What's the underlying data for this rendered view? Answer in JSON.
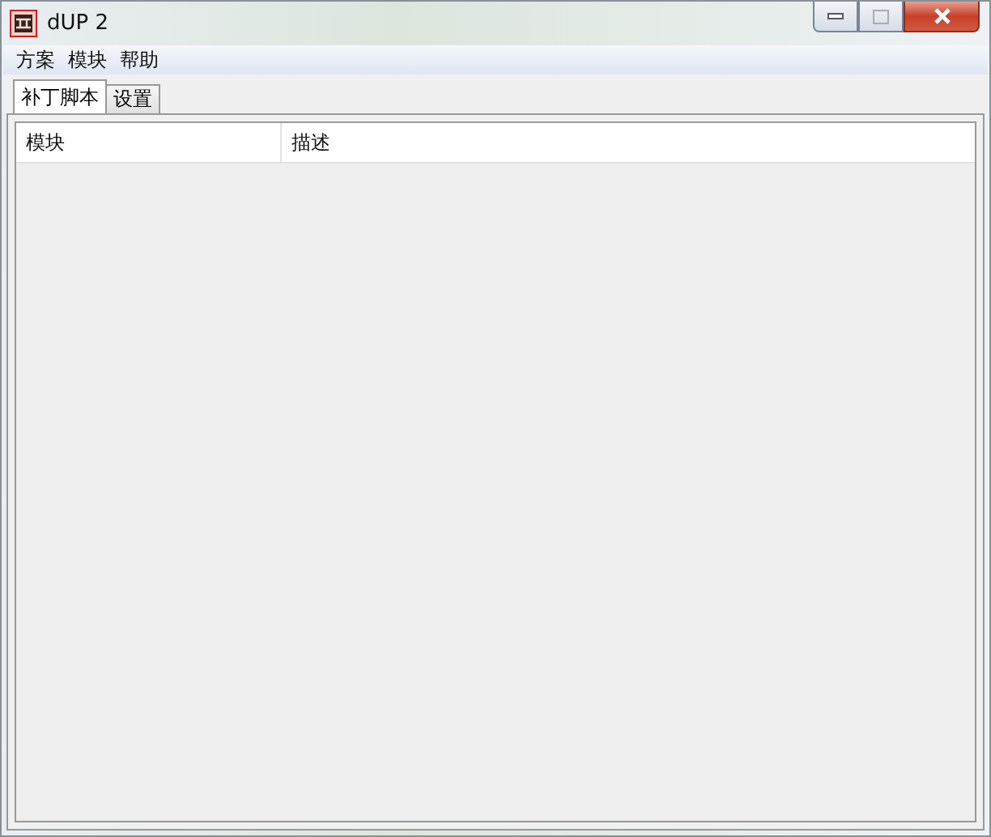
{
  "window": {
    "title": "dUP 2"
  },
  "menu": [
    "方案",
    "模块",
    "帮助"
  ],
  "tabs": [
    {
      "label": "补丁脚本",
      "selected": true
    },
    {
      "label": "设置",
      "selected": false
    }
  ],
  "table": {
    "columns": [
      "模块",
      "描述"
    ]
  }
}
